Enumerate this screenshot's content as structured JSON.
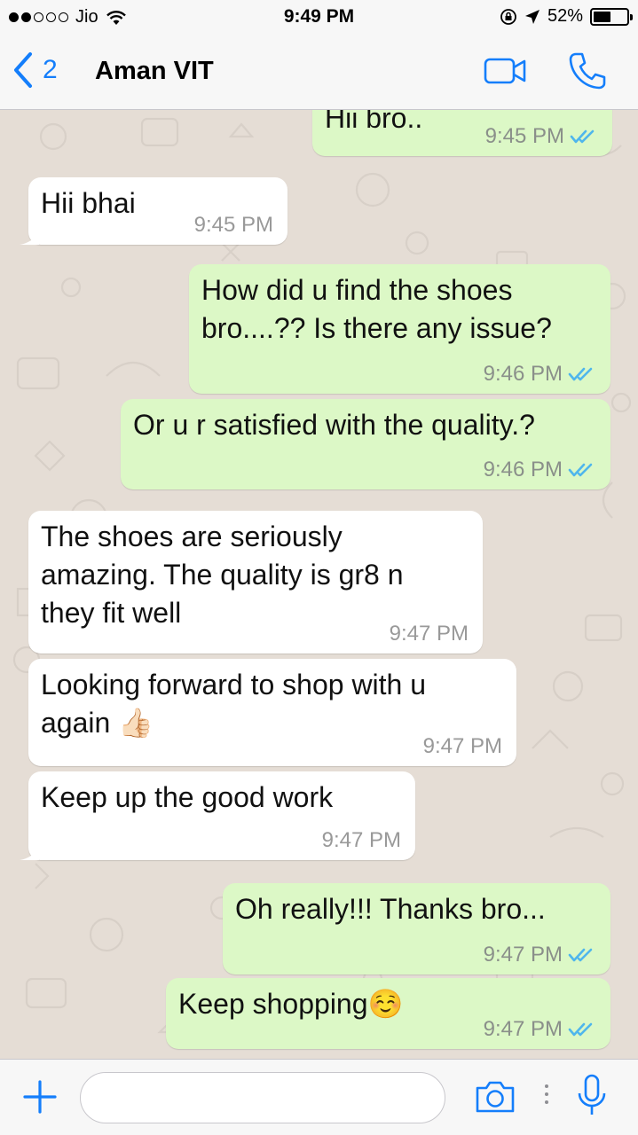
{
  "status_bar": {
    "carrier": "Jio",
    "time": "9:49 PM",
    "battery": "52%",
    "battery_level": 0.52,
    "signal_bars_filled": 2,
    "signal_bars_total": 5
  },
  "header": {
    "back_count": "2",
    "contact_name": "Aman VIT",
    "icons": [
      "chevron-left-icon",
      "video-call-icon",
      "phone-icon"
    ]
  },
  "messages": [
    {
      "dir": "out",
      "lines": [
        "Hii bro.."
      ],
      "time": "9:45 PM",
      "read": true
    },
    {
      "dir": "in",
      "lines": [
        "Hii bhai"
      ],
      "time": "9:45 PM"
    },
    {
      "dir": "out",
      "lines": [
        "How did u find the shoes",
        "bro....?? Is there any issue?"
      ],
      "time": "9:46 PM",
      "read": true
    },
    {
      "dir": "out",
      "lines": [
        "Or u r satisfied with the quality.?"
      ],
      "time": "9:46 PM",
      "read": true
    },
    {
      "dir": "in",
      "lines": [
        "The shoes are seriously",
        "amazing. The quality is gr8 n",
        "they fit well"
      ],
      "time": "9:47 PM"
    },
    {
      "dir": "in",
      "lines": [
        "Looking forward to shop with u",
        "again 👍🏻"
      ],
      "time": "9:47 PM"
    },
    {
      "dir": "in",
      "lines": [
        "Keep up the good work"
      ],
      "time": "9:47 PM"
    },
    {
      "dir": "out",
      "lines": [
        "Oh really!!! Thanks bro..."
      ],
      "time": "9:47 PM",
      "read": true
    },
    {
      "dir": "out",
      "lines": [
        "Keep shopping☺️"
      ],
      "time": "9:47 PM",
      "read": true
    }
  ],
  "input_bar": {
    "placeholder": "",
    "icons": [
      "plus-icon",
      "camera-icon",
      "microphone-icon"
    ]
  },
  "colors": {
    "accent": "#147efb",
    "outgoing_bubble": "#dcf8c6",
    "incoming_bubble": "#ffffff",
    "chat_background": "#e5ddd5",
    "read_ticks": "#4fb6ec"
  }
}
